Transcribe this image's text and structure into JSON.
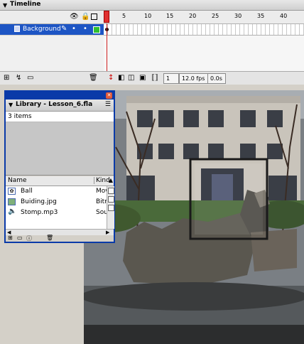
{
  "timeline": {
    "title": "Timeline",
    "header_icons": [
      "eye-icon",
      "lock-icon",
      "outline-icon"
    ],
    "frame_numbers": [
      "1",
      "5",
      "10",
      "15",
      "20",
      "25",
      "30",
      "35",
      "40"
    ],
    "layer": {
      "name": "Background"
    },
    "status": {
      "current_frame": "1",
      "frame_rate": "12.0 fps",
      "elapsed_time": "0.0s"
    }
  },
  "library": {
    "title": "Library - Lesson_6.fla",
    "item_count": "3 items",
    "columns": {
      "name": "Name",
      "kind": "Kind"
    },
    "items": [
      {
        "name": "Ball",
        "kind": "Mov",
        "icon": "movieclip-icon"
      },
      {
        "name": "Buiding.jpg",
        "kind": "Bitm",
        "icon": "bitmap-icon"
      },
      {
        "name": "Stomp.mp3",
        "kind": "Sou",
        "icon": "sound-icon"
      }
    ]
  },
  "colors": {
    "selected_layer": "#1d55c4",
    "playhead": "#e03030",
    "library_border": "#0a3aa8"
  }
}
